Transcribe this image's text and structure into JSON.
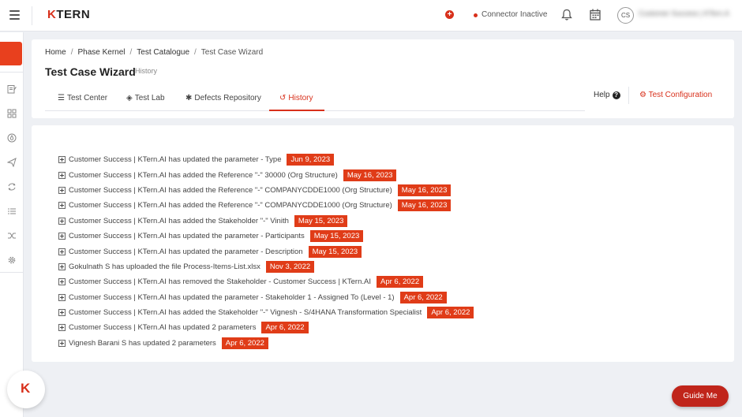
{
  "topbar": {
    "logo_k": "K",
    "logo_rest": "TERN",
    "connector_label": "Connector Inactive",
    "avatar_initials": "CS",
    "user_name": "Customer Success | KTern.AI",
    "icons": [
      "menu-icon",
      "plus-circle-icon",
      "bell-icon",
      "calendar-icon"
    ],
    "accent_color": "#d8301b"
  },
  "breadcrumb": {
    "items": [
      "Home",
      "Phase Kernel",
      "Test Catalogue"
    ],
    "current": "Test Case Wizard"
  },
  "page": {
    "title": "Test Case Wizard",
    "subtitle": "History"
  },
  "tabs": [
    {
      "label": "Test Center",
      "icon": "list-icon"
    },
    {
      "label": "Test Lab",
      "icon": "cube-icon"
    },
    {
      "label": "Defects Repository",
      "icon": "bug-icon"
    },
    {
      "label": "History",
      "icon": "history-icon",
      "active": true
    }
  ],
  "header_actions": {
    "help_label": "Help",
    "help_icon": "?",
    "config_label": "Test Configuration"
  },
  "history": [
    {
      "text": "Customer Success | KTern.AI has updated the parameter - Type",
      "date": "Jun 9, 2023"
    },
    {
      "text": "Customer Success | KTern.AI has added the Reference \"-\" 30000 (Org Structure)",
      "date": "May 16, 2023"
    },
    {
      "text": "Customer Success | KTern.AI has added the Reference \"-\" COMPANYCDDE1000 (Org Structure)",
      "date": "May 16, 2023"
    },
    {
      "text": "Customer Success | KTern.AI has added the Reference \"-\" COMPANYCDDE1000 (Org Structure)",
      "date": "May 16, 2023"
    },
    {
      "text": "Customer Success | KTern.AI has added the Stakeholder \"-\" Vinith",
      "date": "May 15, 2023"
    },
    {
      "text": "Customer Success | KTern.AI has updated the parameter - Participants",
      "date": "May 15, 2023"
    },
    {
      "text": "Customer Success | KTern.AI has updated the parameter - Description",
      "date": "May 15, 2023"
    },
    {
      "text": "Gokulnath S has uploaded the file Process-Items-List.xlsx",
      "date": "Nov 3, 2022"
    },
    {
      "text": "Customer Success | KTern.AI has removed the Stakeholder - Customer Success | KTern.AI",
      "date": "Apr 6, 2022"
    },
    {
      "text": "Customer Success | KTern.AI has updated the parameter - Stakeholder 1 - Assigned To (Level - 1)",
      "date": "Apr 6, 2022"
    },
    {
      "text": "Customer Success | KTern.AI has added the Stakeholder \"-\" Vignesh - S/4HANA Transformation Specialist",
      "date": "Apr 6, 2022"
    },
    {
      "text": "Customer Success | KTern.AI has updated 2 parameters",
      "date": "Apr 6, 2022"
    },
    {
      "text": "Vignesh Barani S has updated 2 parameters",
      "date": "Apr 6, 2022"
    }
  ],
  "floating": {
    "fab_letter": "K",
    "guide_label": "Guide Me"
  }
}
